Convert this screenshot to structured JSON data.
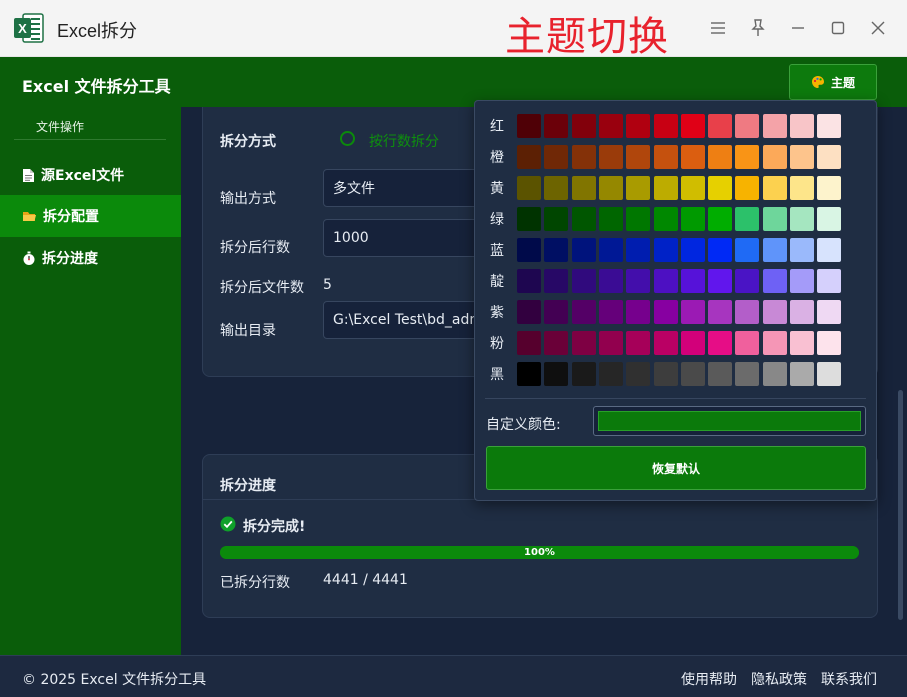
{
  "window": {
    "title": "Excel拆分",
    "overlay_title": "主题切换",
    "app_icon_letter": "X"
  },
  "header": {
    "title": "Excel 文件拆分工具",
    "theme_button": "主题"
  },
  "sidebar": {
    "section_label": "文件操作",
    "items": [
      {
        "label": "源Excel文件",
        "icon": "document-icon",
        "active": false
      },
      {
        "label": "拆分配置",
        "icon": "folder-icon",
        "active": true
      },
      {
        "label": "拆分进度",
        "icon": "stopwatch-icon",
        "active": false
      }
    ]
  },
  "config": {
    "split_mode_label": "拆分方式",
    "split_mode_option": "按行数拆分",
    "output_mode_label": "输出方式",
    "output_mode_value": "多文件",
    "rows_per_file_label": "拆分后行数",
    "rows_per_file_value": "1000",
    "file_count_label": "拆分后文件数",
    "file_count_value": "5",
    "output_dir_label": "输出目录",
    "output_dir_value": "G:\\Excel Test\\bd_admin"
  },
  "progress": {
    "title": "拆分进度",
    "status": "拆分完成!",
    "percent": 100,
    "percent_text": "100%",
    "rows_done_label": "已拆分行数",
    "rows_done_value": "4441 / 4441"
  },
  "palette": {
    "rows": [
      {
        "label": "红",
        "colors": [
          "#4f0006",
          "#6b0009",
          "#82000b",
          "#99000e",
          "#b00010",
          "#c80013",
          "#e00016",
          "#e8404a",
          "#ef7a82",
          "#f4a3a8",
          "#f8c5c8",
          "#fbe3e4"
        ]
      },
      {
        "label": "橙",
        "colors": [
          "#5c2004",
          "#702806",
          "#843108",
          "#9a3b0a",
          "#b0460c",
          "#c5510e",
          "#db5e10",
          "#ee7f13",
          "#f99416",
          "#fca959",
          "#fdc48c",
          "#fde0c2"
        ]
      },
      {
        "label": "黄",
        "colors": [
          "#5b5300",
          "#6d6400",
          "#817500",
          "#958800",
          "#a99b00",
          "#bdac00",
          "#d0bd00",
          "#e6d000",
          "#f7b300",
          "#fcd14f",
          "#fde58a",
          "#fdf3cc"
        ]
      },
      {
        "label": "绿",
        "colors": [
          "#003300",
          "#004600",
          "#005600",
          "#006600",
          "#007700",
          "#008800",
          "#009a00",
          "#00ad00",
          "#2cc16a",
          "#6ed69b",
          "#a5e6c0",
          "#d9f5e4"
        ]
      },
      {
        "label": "蓝",
        "colors": [
          "#000a4a",
          "#000f63",
          "#00137c",
          "#001895",
          "#001daf",
          "#0022c7",
          "#0026e0",
          "#0029f5",
          "#1f6af5",
          "#5f94fa",
          "#9ab9fb",
          "#d7e3fd"
        ]
      },
      {
        "label": "靛",
        "colors": [
          "#1e0650",
          "#270866",
          "#300a7d",
          "#3a0c94",
          "#430eab",
          "#4d10c2",
          "#5612d9",
          "#6116ed",
          "#4a14c5",
          "#6e61f5",
          "#a49bf9",
          "#d5d0fc"
        ]
      },
      {
        "label": "紫",
        "colors": [
          "#32003f",
          "#430053",
          "#540066",
          "#65007a",
          "#76008d",
          "#8700a1",
          "#9b1ab4",
          "#a735bf",
          "#b35ec9",
          "#c889d6",
          "#dab1e4",
          "#efd9f3"
        ]
      },
      {
        "label": "粉",
        "colors": [
          "#56002d",
          "#6a0038",
          "#7e0043",
          "#92004e",
          "#a60059",
          "#ba0064",
          "#d2007a",
          "#e60d86",
          "#f0609d",
          "#f596b6",
          "#f9c0d2",
          "#fde3ec"
        ]
      },
      {
        "label": "黑",
        "colors": [
          "#000000",
          "#0f0f0f",
          "#1a1a1a",
          "#262626",
          "#303030",
          "#3d3d3d",
          "#4a4a4a",
          "#5a5a5a",
          "#6b6b6b",
          "#888888",
          "#aaaaaa",
          "#dddddd"
        ]
      }
    ],
    "custom_label": "自定义颜色:",
    "custom_color": "#0b7a0b",
    "reset_button": "恢复默认"
  },
  "footer": {
    "copyright": "© 2025 Excel 文件拆分工具",
    "links": [
      "使用帮助",
      "隐私政策",
      "联系我们"
    ]
  },
  "colors": {
    "accent": "#0b8a0b",
    "header_bg": "#0a5d0a",
    "main_bg": "#17233a",
    "card_bg": "#1f2d43"
  }
}
